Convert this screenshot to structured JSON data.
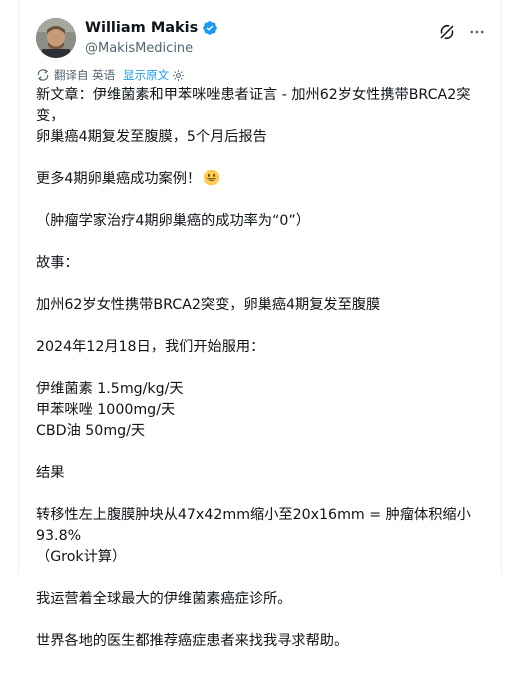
{
  "author": {
    "display_name": "William Makis",
    "handle": "@MakisMedicine"
  },
  "translation_bar": {
    "translated_from": "翻译自 英语",
    "show_original": "显示原文"
  },
  "post": {
    "headline_line1": "新文章：伊维菌素和甲苯咪唑患者证言 - 加州62岁女性携带BRCA2突变，",
    "headline_line2": "卵巢癌4期复发至腹膜，5个月后报告",
    "more_cases": "更多4期卵巢癌成功案例！",
    "oncologist_rate": "（肿瘤学家治疗4期卵巢癌的成功率为“0”）",
    "story_label": "故事：",
    "story_text": "加州62岁女性携带BRCA2突变，卵巢癌4期复发至腹膜",
    "start_date": "2024年12月18日，我们开始服用：",
    "med_1": "伊维菌素 1.5mg/kg/天",
    "med_2": "甲苯咪唑 1000mg/天",
    "med_3": "CBD油 50mg/天",
    "results_label": "结果",
    "results_line1": "转移性左上腹膜肿块从47x42mm缩小至20x16mm = 肿瘤体积缩小93.8%",
    "results_line2": "（Grok计算）",
    "clinic": "我运营着全球最大的伊维菌素癌症诊所。",
    "doctors": "世界各地的医生都推荐癌症患者来找我寻求帮助。"
  },
  "colors": {
    "text": "#0f1419",
    "muted": "#536471",
    "accent": "#1d9bf0"
  },
  "icons": [
    "verified-badge-icon",
    "grok-icon",
    "more-icon",
    "translate-icon",
    "gear-icon",
    "smiley-emoji-icon"
  ]
}
